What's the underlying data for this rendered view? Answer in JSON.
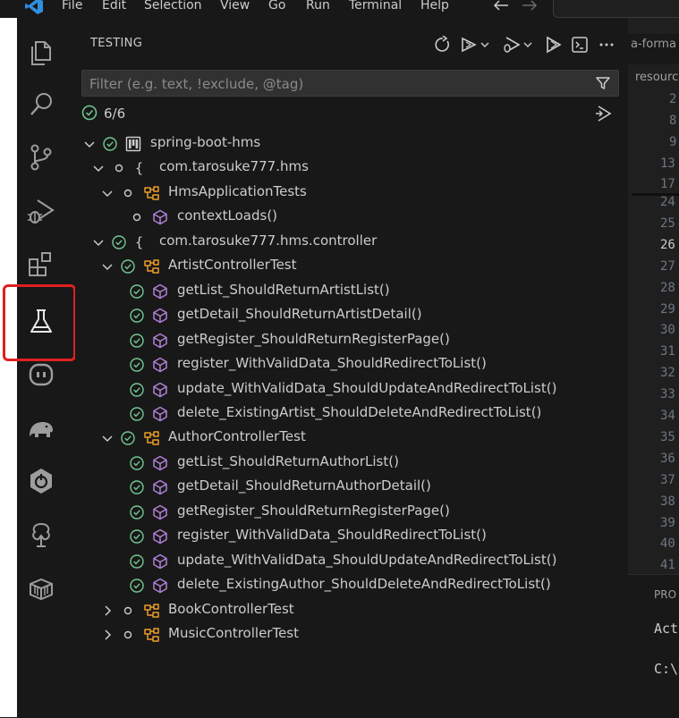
{
  "menu": [
    "File",
    "Edit",
    "Selection",
    "View",
    "Go",
    "Run",
    "Terminal",
    "Help"
  ],
  "nav": {
    "back_icon": "arrow-left-icon",
    "forward_icon": "arrow-right-icon"
  },
  "activity_bar": {
    "items": [
      "explorer-icon",
      "search-icon",
      "source-control-icon",
      "run-debug-icon",
      "extensions-icon",
      "testing-icon",
      "copilot-icon",
      "gradle-elephant-icon",
      "spring-boot-icon",
      "tree-icon",
      "package-box-icon"
    ],
    "highlight_color": "#e02020"
  },
  "sidebar": {
    "title": "TESTING",
    "toolbar_icons": [
      "refresh-icon",
      "run-tests-icon",
      "debug-tests-icon",
      "run-coverage-icon",
      "terminal-icon",
      "more-icon"
    ],
    "filter_placeholder": "Filter (e.g. text, !exclude, @tag)",
    "summary": "6/6"
  },
  "tree": [
    {
      "label": "spring-boot-hms",
      "kind": "project",
      "state": "passed",
      "expanded": true
    },
    {
      "label": "com.tarosuke777.hms",
      "kind": "package",
      "state": "none",
      "expanded": true
    },
    {
      "label": "HmsApplicationTests",
      "kind": "class",
      "state": "none",
      "expanded": true
    },
    {
      "label": "contextLoads()",
      "kind": "method",
      "state": "none"
    },
    {
      "label": "com.tarosuke777.hms.controller",
      "kind": "package",
      "state": "passed",
      "expanded": true
    },
    {
      "label": "ArtistControllerTest",
      "kind": "class",
      "state": "passed",
      "expanded": true
    },
    {
      "label": "getList_ShouldReturnArtistList()",
      "kind": "method",
      "state": "passed"
    },
    {
      "label": "getDetail_ShouldReturnArtistDetail()",
      "kind": "method",
      "state": "passed"
    },
    {
      "label": "getRegister_ShouldReturnRegisterPage()",
      "kind": "method",
      "state": "passed"
    },
    {
      "label": "register_WithValidData_ShouldRedirectToList()",
      "kind": "method",
      "state": "passed"
    },
    {
      "label": "update_WithValidData_ShouldUpdateAndRedirectToList()",
      "kind": "method",
      "state": "passed"
    },
    {
      "label": "delete_ExistingArtist_ShouldDeleteAndRedirectToList()",
      "kind": "method",
      "state": "passed"
    },
    {
      "label": "AuthorControllerTest",
      "kind": "class",
      "state": "passed",
      "expanded": true
    },
    {
      "label": "getList_ShouldReturnAuthorList()",
      "kind": "method",
      "state": "passed"
    },
    {
      "label": "getDetail_ShouldReturnAuthorDetail()",
      "kind": "method",
      "state": "passed"
    },
    {
      "label": "getRegister_ShouldReturnRegisterPage()",
      "kind": "method",
      "state": "passed"
    },
    {
      "label": "register_WithValidData_ShouldRedirectToList()",
      "kind": "method",
      "state": "passed"
    },
    {
      "label": "update_WithValidData_ShouldUpdateAndRedirectToList()",
      "kind": "method",
      "state": "passed"
    },
    {
      "label": "delete_ExistingAuthor_ShouldDeleteAndRedirectToList()",
      "kind": "method",
      "state": "passed"
    },
    {
      "label": "BookControllerTest",
      "kind": "class",
      "state": "none",
      "expanded": false
    },
    {
      "label": "MusicControllerTest",
      "kind": "class",
      "state": "none",
      "expanded": false
    }
  ],
  "editor": {
    "tab": "a-forma",
    "breadcrumb": "resourc",
    "sticky_lines": [
      "2",
      "8",
      "9",
      "13",
      "17"
    ],
    "lines": [
      "24",
      "25",
      "26",
      "27",
      "28",
      "29",
      "30",
      "31",
      "32",
      "33",
      "34",
      "35",
      "36",
      "37",
      "38",
      "39",
      "40",
      "41"
    ],
    "active_line": "26"
  },
  "panel": {
    "tab": "PRO",
    "terminal_lines": [
      "Act",
      "C:\\"
    ]
  },
  "colors": {
    "passed": "#73c991",
    "class_icon": "#ee9d28",
    "method_icon": "#b180d7",
    "background": "#181818"
  }
}
